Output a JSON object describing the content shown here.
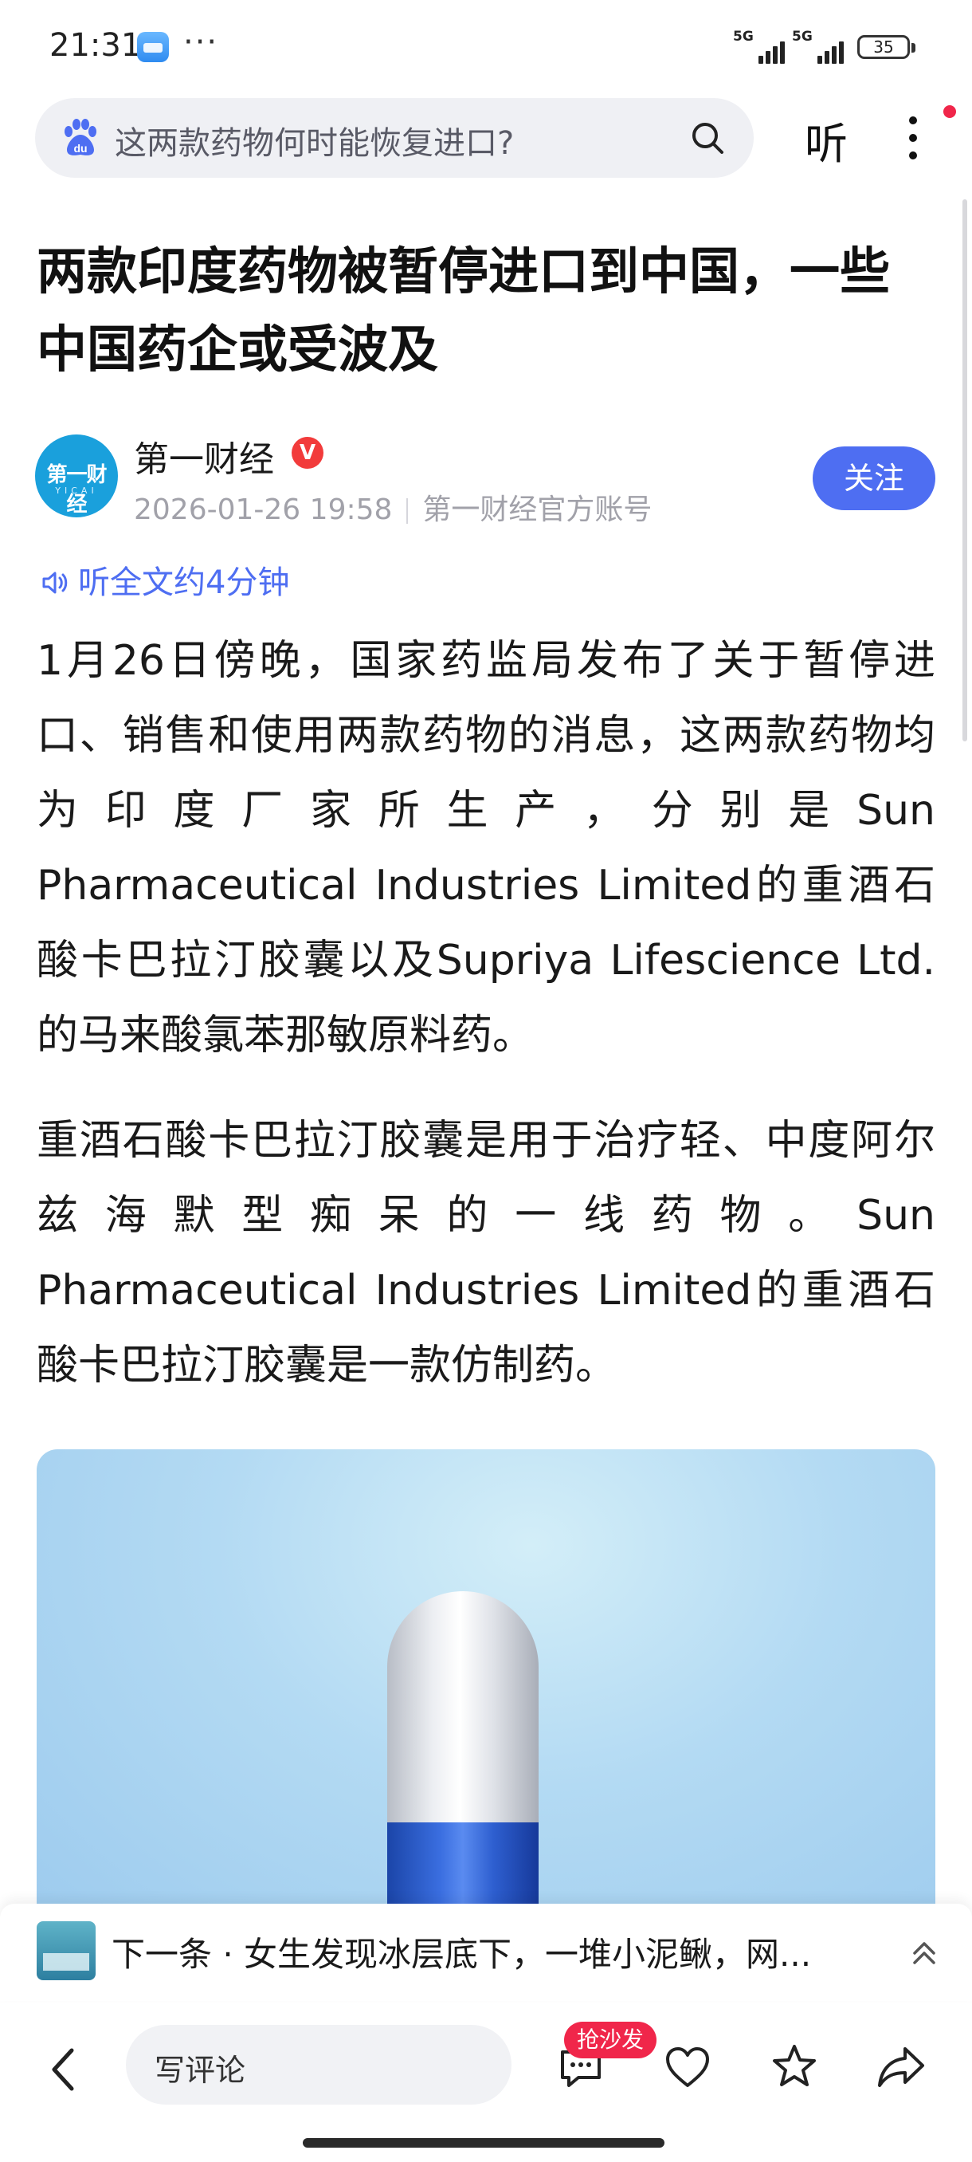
{
  "status_bar": {
    "time": "21:31",
    "dots": "···",
    "network_1": "5G",
    "network_2": "5G",
    "battery": "35"
  },
  "search": {
    "query": "这两款药物何时能恢复进口?",
    "listen_label": "听"
  },
  "article": {
    "title": "两款印度药物被暂停进口到中国，一些中国药企或受波及",
    "author": "第一财经",
    "verified_badge": "V",
    "avatar_text": "第一财经",
    "avatar_subtext": "YICAI",
    "timestamp": "2026-01-26 19:58",
    "source": "第一财经官方账号",
    "follow_label": "关注",
    "listen_all": "听全文约4分钟",
    "paragraphs": [
      "1月26日傍晚，国家药监局发布了关于暂停进口、销售和使用两款药物的消息，这两款药物均为印度厂家所生产，分别是Sun Pharmaceutical Industries Limited的重酒石酸卡巴拉汀胶囊以及Supriya Lifescience Ltd.的马来酸氯苯那敏原料药。",
      "重酒石酸卡巴拉汀胶囊是用于治疗轻、中度阿尔兹海默型痴呆的一线药物。Sun Pharmaceutical Industries Limited的重酒石酸卡巴拉汀胶囊是一款仿制药。"
    ]
  },
  "next_article": {
    "text": "下一条 · 女生发现冰层底下，一堆小泥鳅，网..."
  },
  "toolbar": {
    "comment_placeholder": "写评论",
    "sofa_badge": "抢沙发"
  },
  "colors": {
    "accent": "#4e6ef2",
    "badge_red": "#f0264a"
  },
  "icons": [
    "baidu-paw-icon",
    "search-icon",
    "more-icon",
    "speaker-icon",
    "chevron-up-icon",
    "back-icon",
    "comment-icon",
    "heart-icon",
    "star-icon",
    "share-icon"
  ]
}
